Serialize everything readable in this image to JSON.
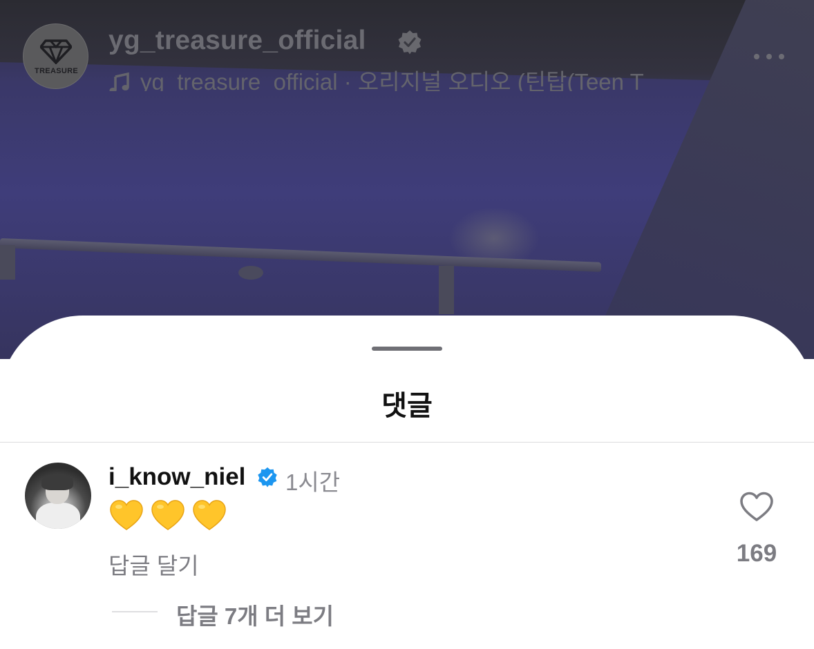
{
  "video": {
    "account_name": "yg_treasure_official",
    "avatar_logo_text": "TREASURE",
    "audio_text": "yg_treasure_official · 오리지널 오디오  (틴탑(Teen T"
  },
  "comments_sheet": {
    "title": "댓글",
    "comments": [
      {
        "username": "i_know_niel",
        "time": "1시간",
        "text": "💛💛💛",
        "reply_label": "답글 달기",
        "like_count": "169",
        "view_replies_label": "답글 7개 더 보기"
      }
    ]
  },
  "colors": {
    "verified_blue": "#1c96f0",
    "emoji_yellow": "#ffc52a",
    "secondary_text": "#7c7c82"
  },
  "icons": [
    "music-note-icon",
    "verified-badge-icon",
    "more-options-icon",
    "heart-outline-icon",
    "yellow-heart-emoji"
  ]
}
